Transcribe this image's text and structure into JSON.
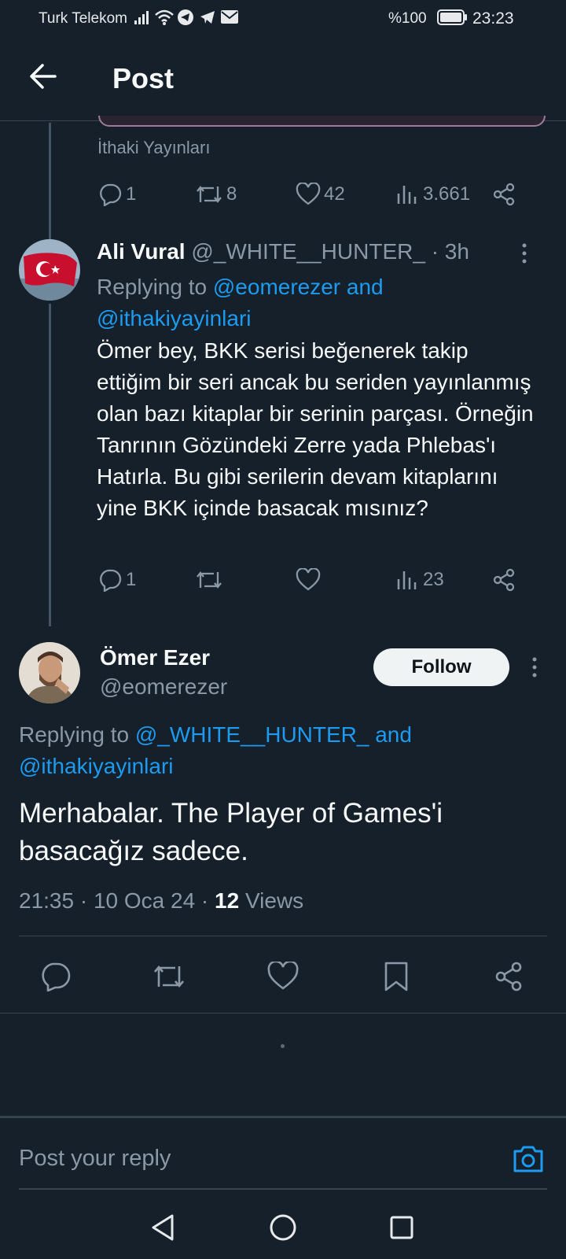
{
  "status_bar": {
    "carrier": "Turk Telekom",
    "battery": "%100",
    "time": "23:23",
    "icons": [
      "signal-icon",
      "wifi-icon",
      "telegram-icon",
      "telegram-icon",
      "mail-icon",
      "battery-icon"
    ]
  },
  "header": {
    "title": "Post",
    "back_icon": "back-arrow-icon"
  },
  "parent_post": {
    "source_text": "İthaki Yayınları",
    "replies": "1",
    "reposts": "8",
    "likes": "42",
    "views": "3.661"
  },
  "reply_post": {
    "name": "Ali Vural",
    "handle": "@_WHITE__HUNTER_",
    "time": "· 3h",
    "replying_prefix": "Replying to",
    "replying_line1": "@eomerezer and",
    "replying_line2": "@ithakiyayinlari",
    "body": "Ömer bey, BKK serisi beğenerek takip ettiğim bir seri ancak bu seriden yayınlanmış olan bazı kitaplar bir serinin parçası. Örneğin Tanrının Gözündeki Zerre yada Phlebas'ı Hatırla. Bu gibi serilerin devam kitaplarını yine BKK içinde basacak mısınız?",
    "replies": "1",
    "views": "23"
  },
  "main_post": {
    "name": "Ömer Ezer",
    "handle": "@eomerezer",
    "follow_label": "Follow",
    "replying_prefix": "Replying to",
    "replying_line1": "@_WHITE__HUNTER_ and",
    "replying_line2": "@ithakiyayinlari",
    "body": "Merhabalar. The Player of Games'i basacağız sadece.",
    "timestamp": "21:35 · 10 Oca 24 · ",
    "views_count": "12",
    "views_label": " Views"
  },
  "reply_bar": {
    "placeholder": "Post your reply"
  },
  "colors": {
    "background": "#15202b",
    "accent": "#1d9bf0",
    "muted": "#8b98a5",
    "divider": "#38444d"
  }
}
